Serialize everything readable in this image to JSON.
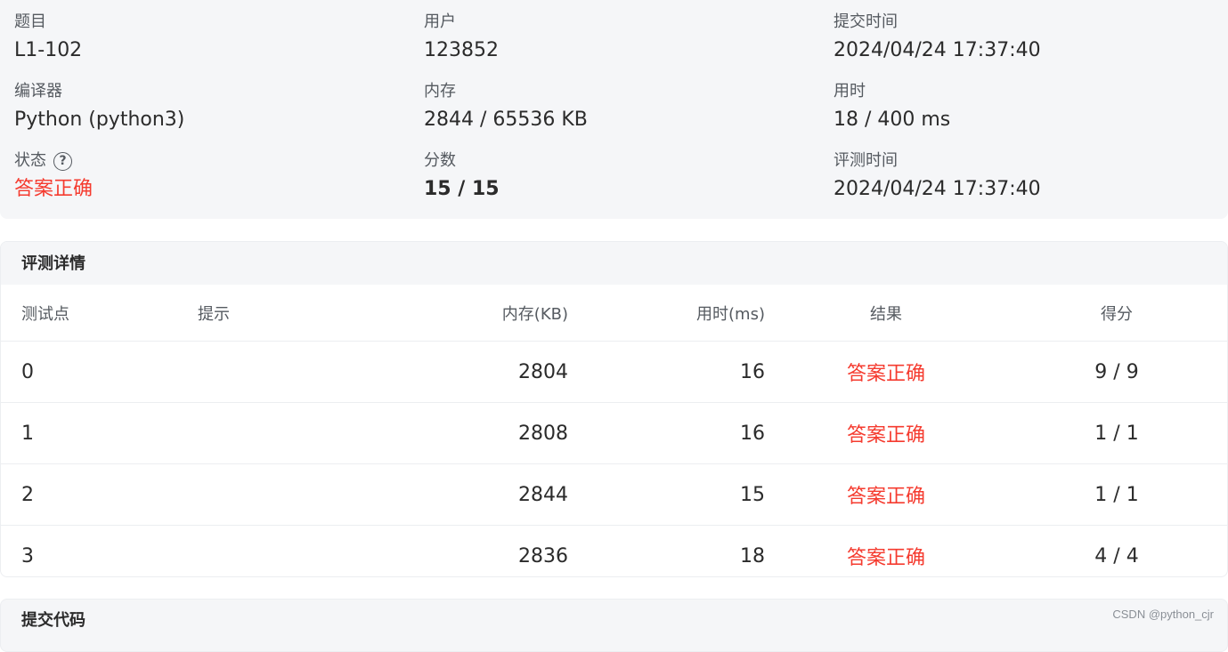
{
  "summary": {
    "problem_label": "题目",
    "problem_value": "L1-102",
    "user_label": "用户",
    "user_value": "123852",
    "submit_time_label": "提交时间",
    "submit_time_value": "2024/04/24 17:37:40",
    "compiler_label": "编译器",
    "compiler_value": "Python (python3)",
    "memory_label": "内存",
    "memory_value": "2844 / 65536 KB",
    "time_label": "用时",
    "time_value": "18 / 400 ms",
    "status_label": "状态",
    "status_help_icon": "?",
    "status_value": "答案正确",
    "score_label": "分数",
    "score_value": "15 / 15",
    "judge_time_label": "评测时间",
    "judge_time_value": "2024/04/24 17:37:40"
  },
  "details": {
    "title": "评测详情",
    "columns": [
      "测试点",
      "提示",
      "内存(KB)",
      "用时(ms)",
      "结果",
      "得分"
    ],
    "rows": [
      {
        "case": "0",
        "hint": "",
        "memory": "2804",
        "time": "16",
        "result": "答案正确",
        "score": "9 / 9"
      },
      {
        "case": "1",
        "hint": "",
        "memory": "2808",
        "time": "16",
        "result": "答案正确",
        "score": "1 / 1"
      },
      {
        "case": "2",
        "hint": "",
        "memory": "2844",
        "time": "15",
        "result": "答案正确",
        "score": "1 / 1"
      },
      {
        "case": "3",
        "hint": "",
        "memory": "2836",
        "time": "18",
        "result": "答案正确",
        "score": "4 / 4"
      }
    ]
  },
  "code_section": {
    "title": "提交代码"
  },
  "watermark": "CSDN @python_cjr",
  "colors": {
    "accepted": "#f53b2f",
    "panel_bg": "#f5f6f8"
  }
}
